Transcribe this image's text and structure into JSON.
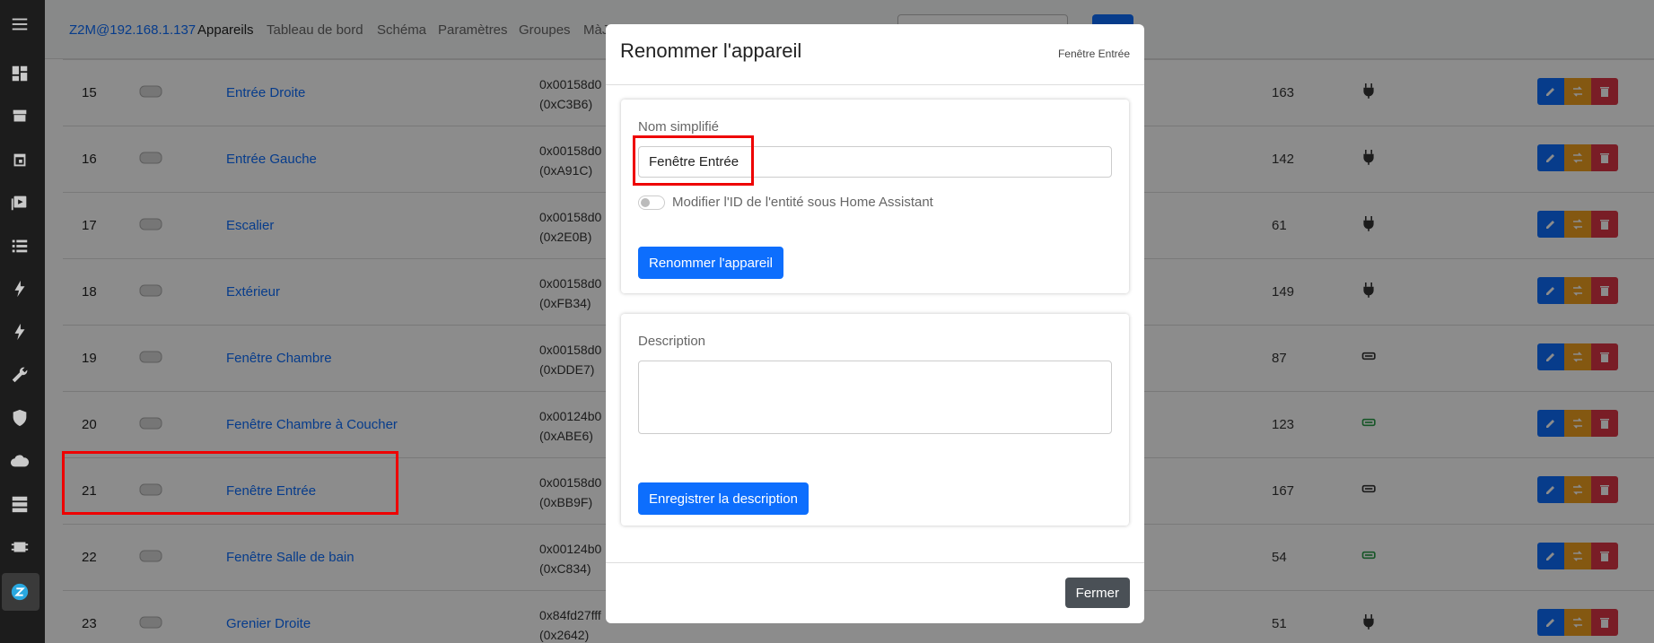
{
  "sidebar": {
    "icons": [
      "menu-icon",
      "dashboard-icon",
      "hacs-icon",
      "calendar-icon",
      "media-icon",
      "list-icon",
      "energy-icon",
      "lightning-icon",
      "wrench-icon",
      "shield-icon",
      "cloud-icon",
      "server-icon",
      "chip-icon",
      "z2m-icon"
    ]
  },
  "navbar": {
    "brand": "Z2M@192.168.1.137",
    "links": [
      "Appareils",
      "Tableau de bord",
      "Schéma",
      "Paramètres",
      "Groupes",
      "MàJ"
    ]
  },
  "devices": [
    {
      "idx": "15",
      "name": "Entrée Droite",
      "ieee": "0x00158d0",
      "nwk": "(0xC3B6)",
      "lqi": "163",
      "power": "plug"
    },
    {
      "idx": "16",
      "name": "Entrée Gauche",
      "ieee": "0x00158d0",
      "nwk": "(0xA91C)",
      "lqi": "142",
      "power": "plug"
    },
    {
      "idx": "17",
      "name": "Escalier",
      "ieee": "0x00158d0",
      "nwk": "(0x2E0B)",
      "lqi": "61",
      "power": "plug"
    },
    {
      "idx": "18",
      "name": "Extérieur",
      "ieee": "0x00158d0",
      "nwk": "(0xFB34)",
      "lqi": "149",
      "power": "plug"
    },
    {
      "idx": "19",
      "name": "Fenêtre Chambre",
      "ieee": "0x00158d0",
      "nwk": "(0xDDE7)",
      "lqi": "87",
      "power": "battery"
    },
    {
      "idx": "20",
      "name": "Fenêtre Chambre à Coucher",
      "ieee": "0x00124b0",
      "nwk": "(0xABE6)",
      "lqi": "123",
      "power": "battery-full"
    },
    {
      "idx": "21",
      "name": "Fenêtre Entrée",
      "ieee": "0x00158d0",
      "nwk": "(0xBB9F)",
      "lqi": "167",
      "power": "battery"
    },
    {
      "idx": "22",
      "name": "Fenêtre Salle de bain",
      "ieee": "0x00124b0",
      "nwk": "(0xC834)",
      "lqi": "54",
      "power": "battery-full"
    },
    {
      "idx": "23",
      "name": "Grenier Droite",
      "ieee": "0x84fd27fff",
      "nwk": "(0x2642)",
      "lqi": "51",
      "power": "plug"
    }
  ],
  "modal": {
    "title": "Renommer l'appareil",
    "subtitle": "Fenêtre Entrée",
    "name_label": "Nom simplifié",
    "name_value": "Fenêtre Entrée",
    "toggle_label": "Modifier l'ID de l'entité sous Home Assistant",
    "rename_button": "Renommer l'appareil",
    "description_label": "Description",
    "description_value": "",
    "save_description_button": "Enregistrer la description",
    "close_button": "Fermer"
  },
  "colors": {
    "primary": "#0d6efd",
    "warning": "#f0a020",
    "danger": "#dc3545",
    "highlight": "#ee0000"
  }
}
